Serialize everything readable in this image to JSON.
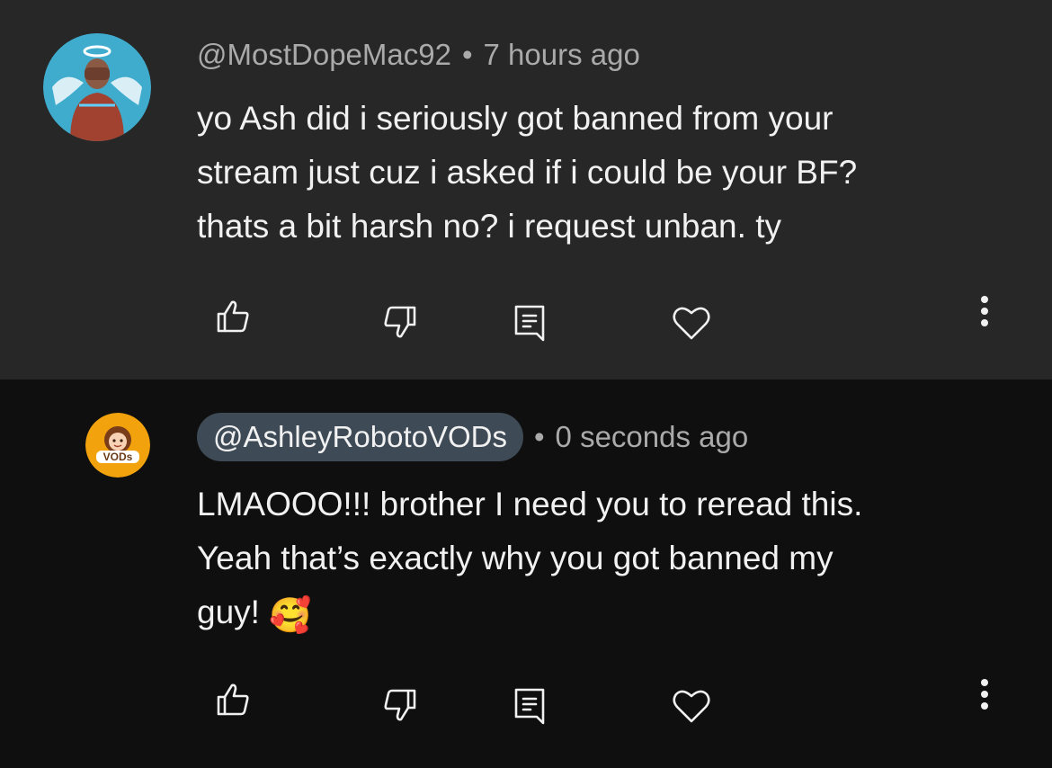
{
  "comments": [
    {
      "handle": "@MostDopeMac92",
      "separator": "•",
      "time": "7 hours ago",
      "lines": [
        "yo Ash did i seriously got banned from your",
        "stream just cuz i asked if i could be your BF?",
        "thats a bit harsh no? i request unban. ty"
      ],
      "avatar": {
        "icon": "angel-avatar-icon",
        "bg": "#4fb8d8"
      }
    },
    {
      "handle": "@AshleyRobotoVODs",
      "separator": "•",
      "time": "0 seconds ago",
      "lines": [
        "LMAOOO!!! brother I need you to reread this.",
        "Yeah that’s exactly why you got banned my",
        "guy!"
      ],
      "emoji": "🥰",
      "avatar": {
        "icon": "vods-avatar-icon",
        "label": "VODs",
        "bg": "#f2a20c"
      }
    }
  ],
  "colors": {
    "card_bg": "#272727",
    "page_bg": "#0f0f0f",
    "text": "#f1f1f1",
    "meta_text": "#aaaaaa",
    "pill_bg": "#3e4a56"
  }
}
